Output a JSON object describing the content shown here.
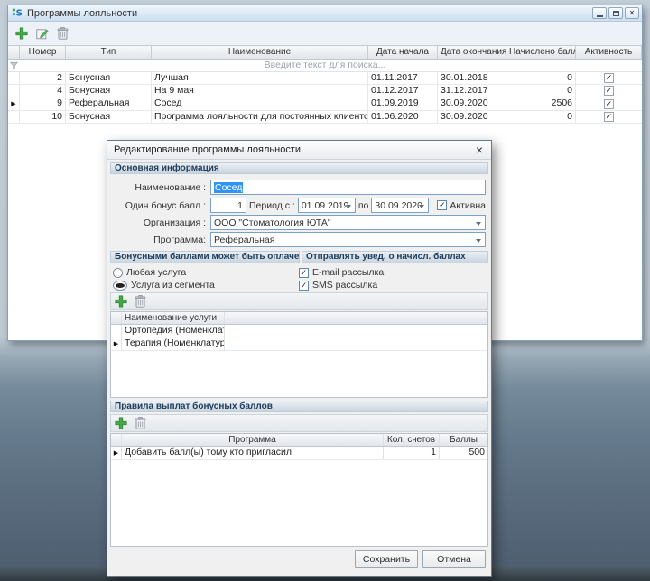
{
  "icons": {
    "checkmark": "✓",
    "row_marker": "▶",
    "close": "×"
  },
  "window": {
    "title": "Программы лояльности",
    "grid": {
      "columns": {
        "number": "Номер",
        "type": "Тип",
        "name": "Наименование",
        "date_start": "Дата начала",
        "date_end": "Дата окончания",
        "points": "Начислено баллов",
        "active": "Активность"
      },
      "filter_placeholder": "Введите текст для поиска...",
      "rows": [
        {
          "number": "2",
          "type": "Бонусная",
          "name": "Лучшая",
          "date_start": "01.11.2017",
          "date_end": "30.01.2018",
          "points": "0",
          "active": true
        },
        {
          "number": "4",
          "type": "Бонусная",
          "name": "На 9 мая",
          "date_start": "01.12.2017",
          "date_end": "31.12.2017",
          "points": "0",
          "active": true
        },
        {
          "number": "9",
          "type": "Реферальная",
          "name": "Сосед",
          "date_start": "01.09.2019",
          "date_end": "30.09.2020",
          "points": "2506",
          "active": true
        },
        {
          "number": "10",
          "type": "Бонусная",
          "name": "Программа лояльности для постоянных клиентов",
          "date_start": "01.06.2020",
          "date_end": "30.09.2020",
          "points": "0",
          "active": true
        }
      ]
    }
  },
  "dialog": {
    "title": "Редактирование программы лояльности",
    "section_main": "Основная информация",
    "fields": {
      "name_label": "Наименование :",
      "name_value": "Сосед",
      "bonus_label": "Один бонус балл :",
      "bonus_value": "1",
      "period_from_label": "Период с :",
      "period_from_value": "01.09.2019",
      "period_to_label": "по",
      "period_to_value": "30.09.2020",
      "active_label": "Активна",
      "org_label": "Организация :",
      "org_value": "ООО \"Стоматология ЮТА\"",
      "program_label": "Программа:",
      "program_value": "Реферальная"
    },
    "section_payment": "Бонусными баллами может быть оплачена",
    "section_notify": "Отправлять увед. о начисл. баллах",
    "payment_options": {
      "any": "Любая услуга",
      "segment": "Услуга из сегмента"
    },
    "notify_options": {
      "email": "E-mail рассылка",
      "sms": "SMS рассылка"
    },
    "services": {
      "column": "Наименование услуги",
      "rows": [
        "Ортопедия (Номенклат",
        "Терапия (Номенклатур"
      ]
    },
    "section_rules": "Правила выплат бонусных баллов",
    "rules": {
      "columns": {
        "program": "Программа",
        "accounts": "Кол. счетов",
        "points": "Баллы"
      },
      "rows": [
        {
          "program": "Добавить балл(ы) тому кто пригласил",
          "accounts": "1",
          "points": "500"
        }
      ]
    },
    "buttons": {
      "save": "Сохранить",
      "cancel": "Отмена"
    }
  }
}
